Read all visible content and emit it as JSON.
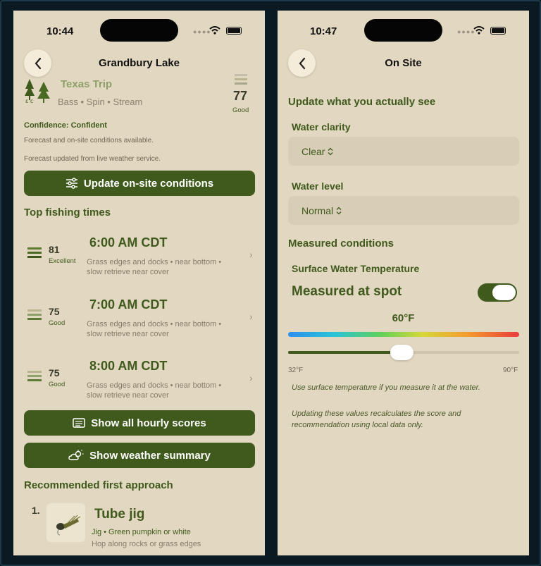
{
  "left": {
    "status_time": "10:44",
    "nav_title": "Grandbury Lake",
    "trip_name": "Texas Trip",
    "species": "Bass • Spin • Stream",
    "header_score": "77",
    "header_score_label": "Good",
    "confidence": "Confidence: Confident",
    "forecast_note": "Forecast and on-site conditions available.",
    "forecast_updated": "Forecast updated from live weather service.",
    "update_button": "Update on-site conditions",
    "top_times_heading": "Top fishing times",
    "slots": [
      {
        "score": "81",
        "label": "Excellent",
        "time": "6:00 AM CDT",
        "desc1": "Grass edges and docks • near bottom •",
        "desc2": "slow retrieve near cover"
      },
      {
        "score": "75",
        "label": "Good",
        "time": "7:00 AM CDT",
        "desc1": "Grass edges and docks • near bottom •",
        "desc2": "slow retrieve near cover"
      },
      {
        "score": "75",
        "label": "Good",
        "time": "8:00 AM CDT",
        "desc1": "Grass edges and docks • near bottom •",
        "desc2": "slow retrieve near cover"
      }
    ],
    "hourly_button": "Show all hourly scores",
    "weather_button": "Show weather summary",
    "approach_heading": "Recommended first approach",
    "approach_index": "1.",
    "lure_name": "Tube jig",
    "lure_detail": "Jig • Green pumpkin or white",
    "lure_tip": "Hop along rocks or grass edges"
  },
  "right": {
    "status_time": "10:47",
    "nav_title": "On Site",
    "update_heading": "Update what you actually see",
    "clarity_label": "Water clarity",
    "clarity_value": "Clear",
    "level_label": "Water level",
    "level_value": "Normal",
    "measured_heading": "Measured conditions",
    "temp_label": "Surface Water Temperature",
    "measured_toggle_label": "Measured at spot",
    "measured_toggle_on": true,
    "temp_value": "60°F",
    "temp_fraction": 0.49,
    "temp_min": "32°F",
    "temp_max": "90°F",
    "hint1": "Use surface temperature if you measure it at the water.",
    "hint2a": "Updating these values recalculates the score and",
    "hint2b": "recommendation using local data only."
  },
  "colors": {
    "accent": "#3f5a1c",
    "background": "#e2d7c0"
  },
  "icons": [
    "chevron-left-icon",
    "wifi-icon",
    "battery-icon",
    "sliders-icon",
    "list-icon",
    "weather-icon",
    "chevron-right-icon",
    "chevron-updown-icon",
    "score-bars-icon",
    "trees-logo-icon",
    "lure-image"
  ]
}
